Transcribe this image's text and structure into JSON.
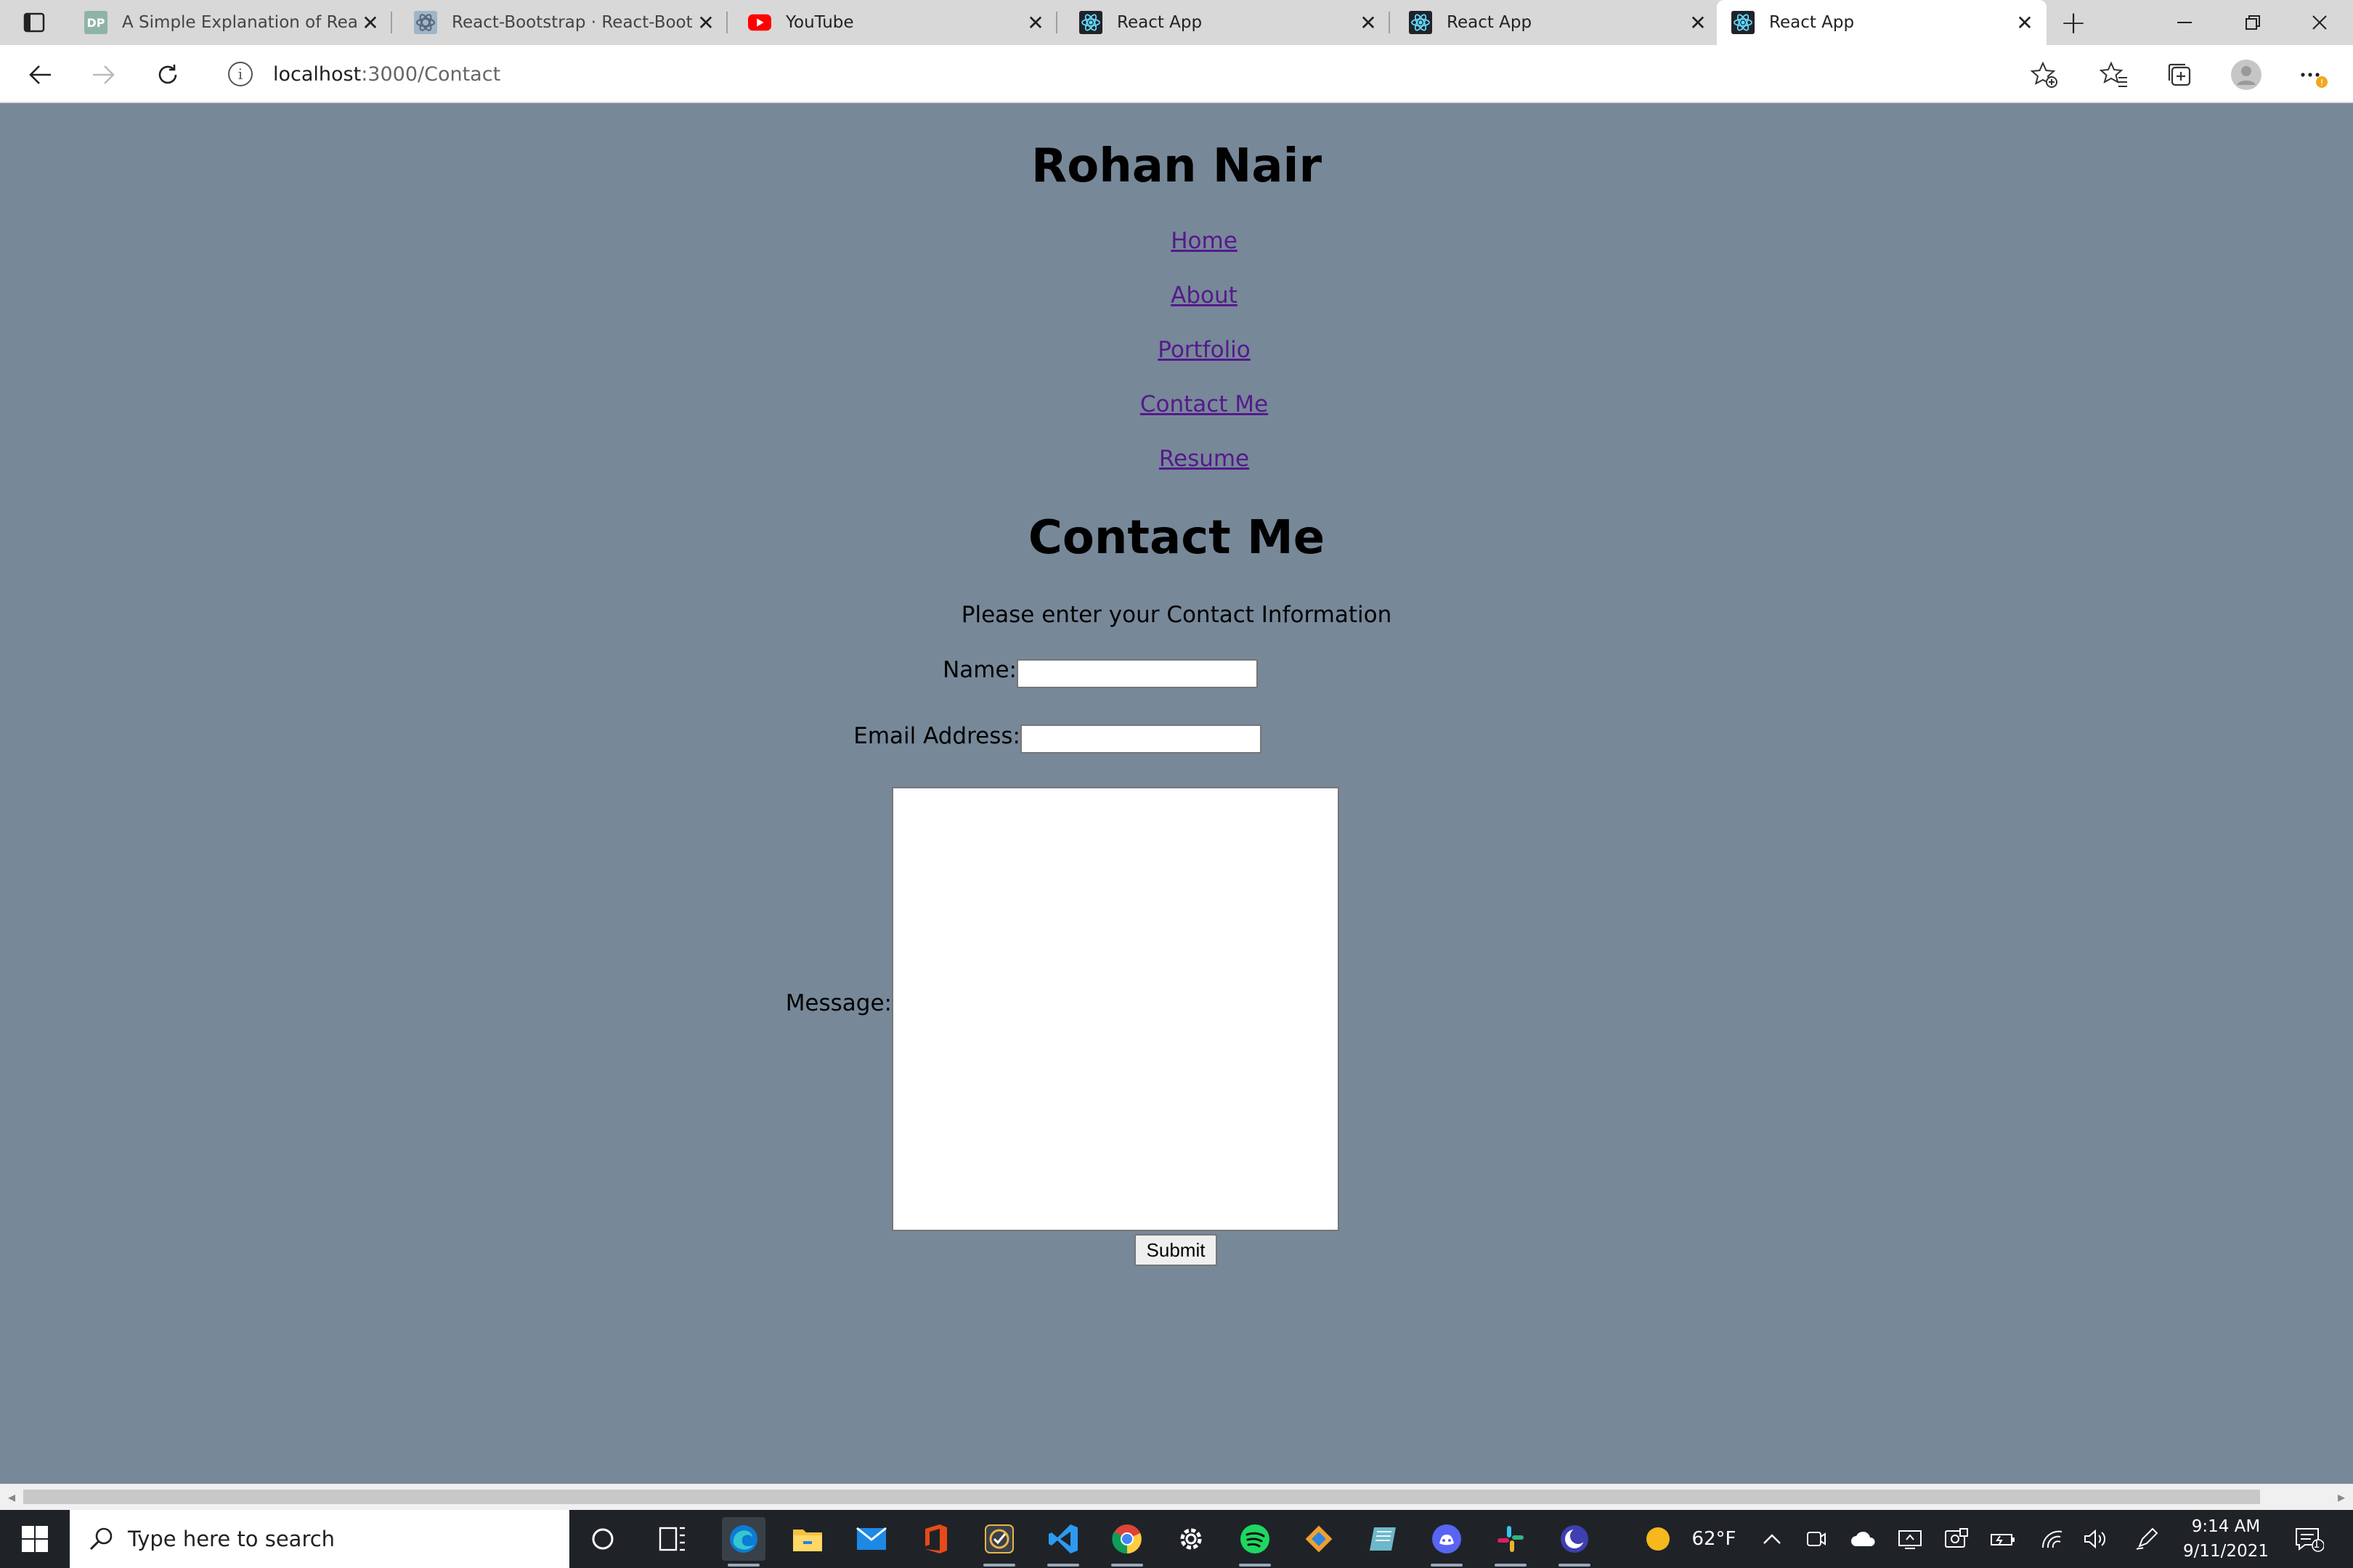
{
  "browser": {
    "tabs": [
      {
        "title": "A Simple Explanation of React",
        "favicon": "dp-favicon",
        "active": false
      },
      {
        "title": "React-Bootstrap · React-Bootst",
        "favicon": "react-bootstrap-favicon",
        "active": false
      },
      {
        "title": "YouTube",
        "favicon": "youtube-favicon",
        "active": false
      },
      {
        "title": "React App",
        "favicon": "react-favicon",
        "active": false
      },
      {
        "title": "React App",
        "favicon": "react-favicon",
        "active": false
      },
      {
        "title": "React App",
        "favicon": "react-favicon",
        "active": true
      }
    ],
    "url_host": "localhost",
    "url_path": ":3000/Contact"
  },
  "page": {
    "site_title": "Rohan Nair",
    "nav": [
      "Home",
      "About",
      "Portfolio",
      "Contact Me",
      "Resume"
    ],
    "heading": "Contact Me",
    "instructions": "Please enter your Contact Information",
    "form": {
      "name_label": "Name:",
      "name_value": "",
      "email_label": "Email Address:",
      "email_value": "",
      "message_label": "Message:",
      "message_value": "",
      "submit_label": "Submit"
    },
    "link_color": "#551a8b",
    "background_color": "#778899"
  },
  "taskbar": {
    "search_placeholder": "Type here to search",
    "weather_temp": "62°F",
    "time": "9:14 AM",
    "date": "9/11/2021",
    "notification_count": "1",
    "apps": [
      "task-view",
      "edge",
      "file-explorer",
      "mail",
      "office",
      "todo",
      "vscode",
      "chrome",
      "settings",
      "spotify",
      "git-tool",
      "notes",
      "discord",
      "slack",
      "browser-app"
    ]
  }
}
